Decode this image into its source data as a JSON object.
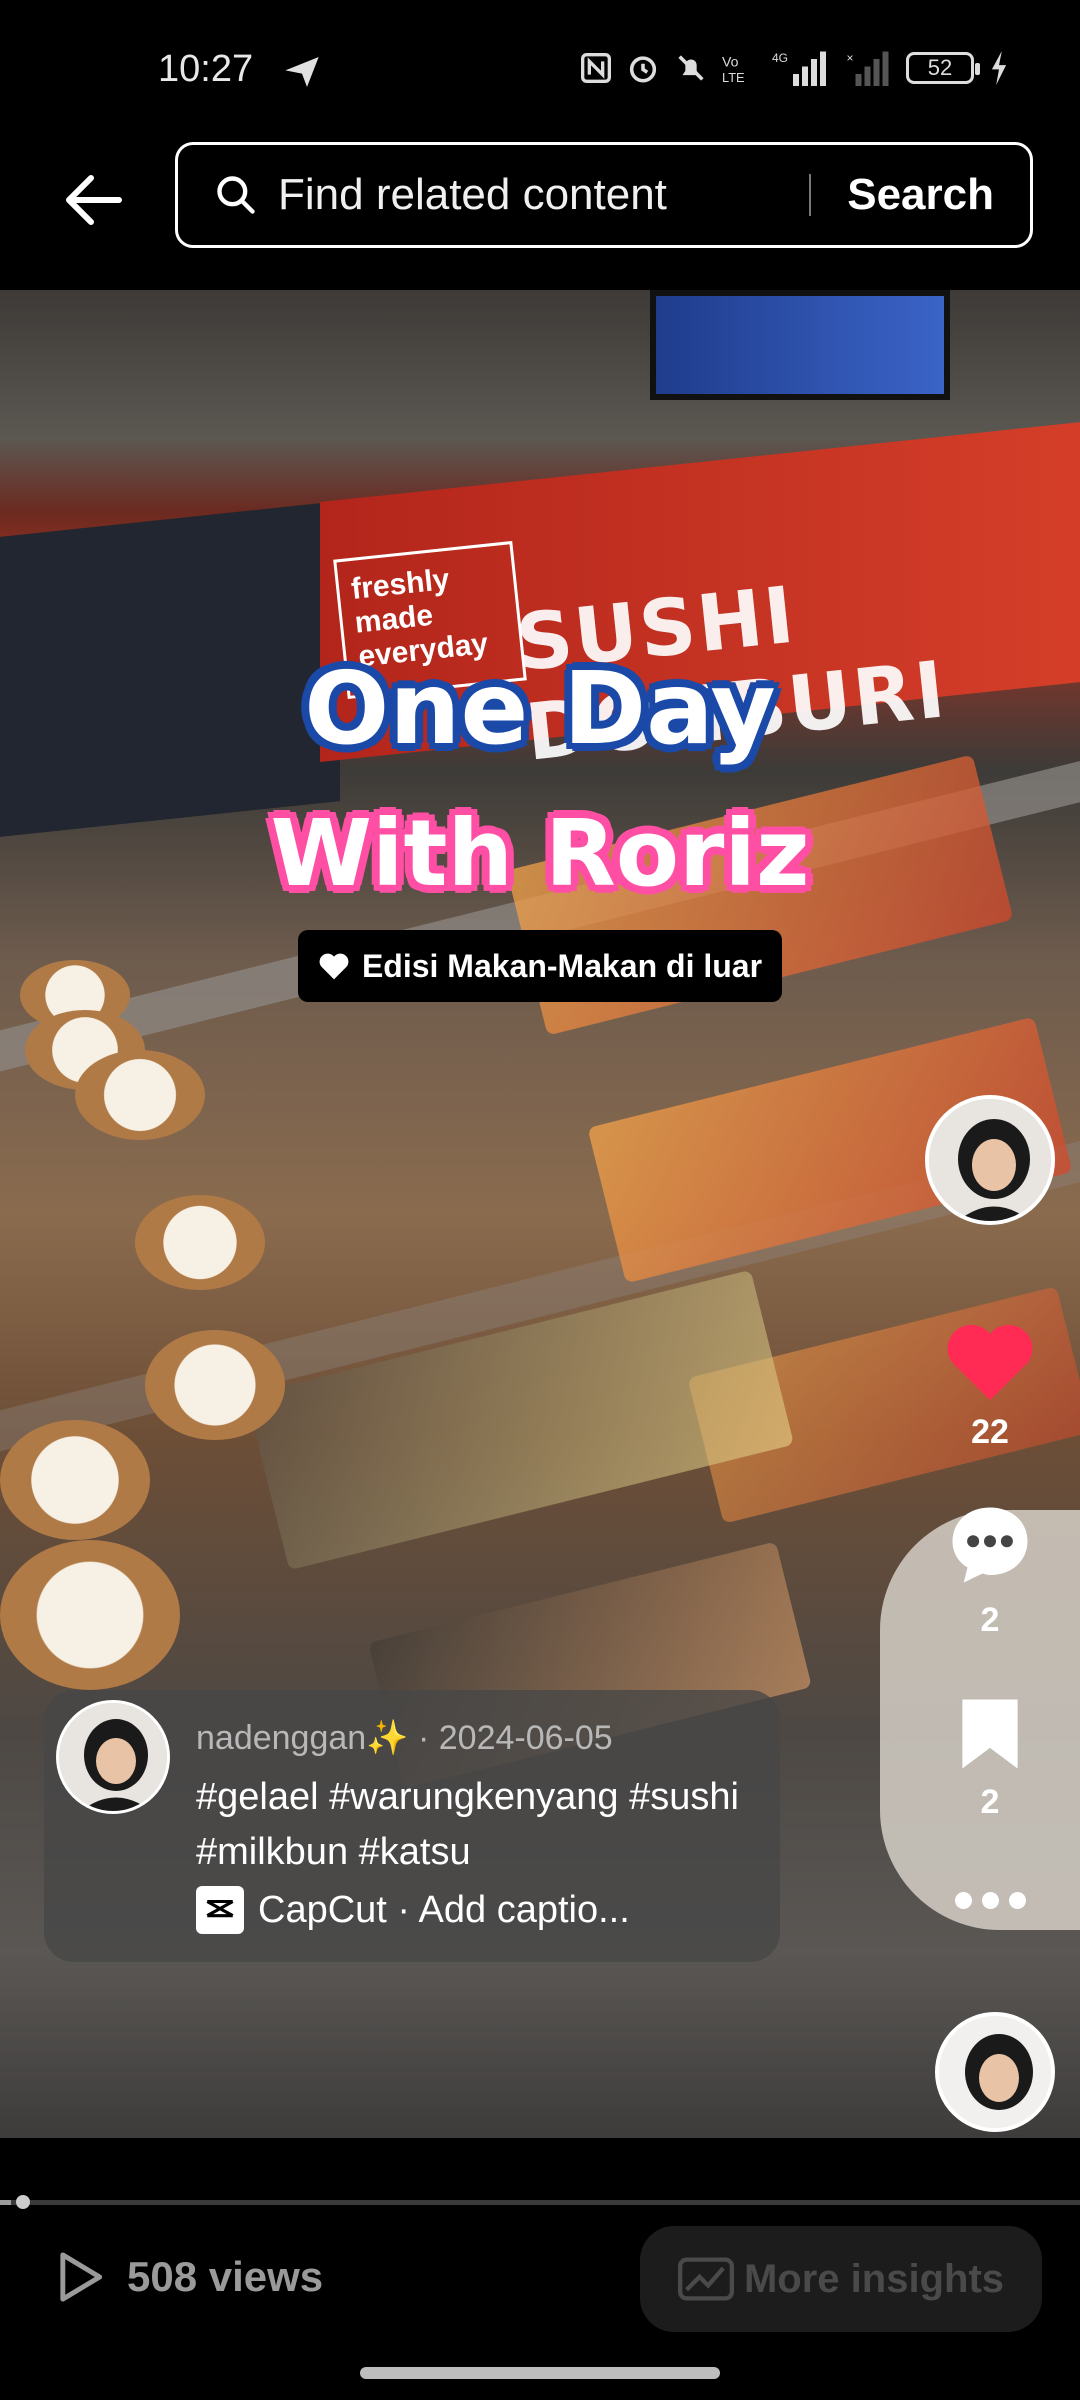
{
  "status_bar": {
    "time": "10:27",
    "battery": "52",
    "icons": [
      "send-icon",
      "nfc-icon",
      "alarm-icon",
      "mute-icon",
      "volte-icon",
      "4g-signal-icon",
      "no-signal-icon",
      "battery-icon",
      "charging-icon"
    ]
  },
  "header": {
    "search_placeholder": "Find related content",
    "search_button": "Search"
  },
  "video": {
    "title_line1": "One Day",
    "title_line2": "With Roriz",
    "subtitle": "Edisi Makan-Makan di luar",
    "progress": 0.01,
    "scene_banner": "SUSHI DONBURI",
    "scene_fresh": "freshly made everyday"
  },
  "actions": {
    "likes": "22",
    "comments": "2",
    "saves": "2"
  },
  "caption": {
    "username": "nadenggan✨",
    "date": "2024-06-05",
    "hashtags": "#gelael #warungkenyang #sushi #milkbun #katsu",
    "capcut": "CapCut · Add captio..."
  },
  "bottom": {
    "views": "508 views",
    "insights": "More insights"
  },
  "colors": {
    "like": "#ff2b55",
    "title_blue": "#1b49a8",
    "title_pink": "#ff4fa4"
  }
}
